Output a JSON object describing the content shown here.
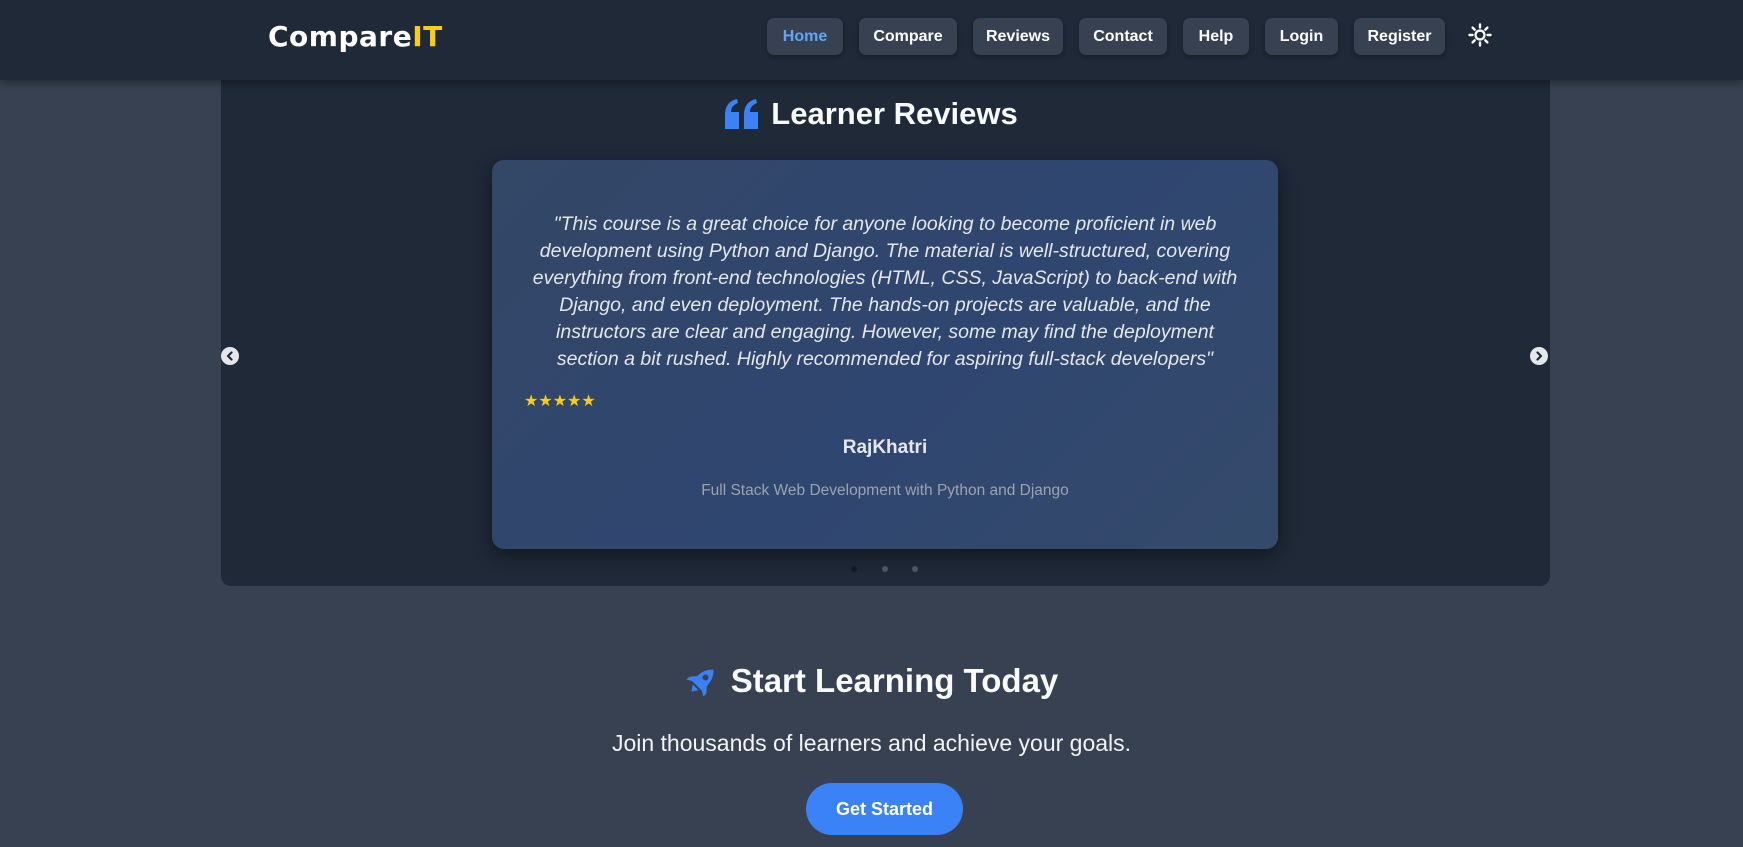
{
  "header": {
    "logo_main": "Compare",
    "logo_accent": "IT",
    "logo_accent_color": "#facc15",
    "nav": [
      {
        "label": "Home",
        "active": true
      },
      {
        "label": "Compare"
      },
      {
        "label": "Reviews"
      },
      {
        "label": "Contact"
      },
      {
        "label": "Help"
      },
      {
        "label": "Login"
      },
      {
        "label": "Register"
      }
    ],
    "theme_toggle_icon": "sun-icon"
  },
  "reviews": {
    "title": "Learner Reviews",
    "title_icon": "quote-icon",
    "review": {
      "text": "\"This course is a great choice for anyone looking to become proficient in web development using Python and Django. The material is well-structured, covering everything from front-end technologies (HTML, CSS, JavaScript) to back-end with Django, and even deployment. The hands-on projects are valuable, and the instructors are clear and engaging. However, some may find the deployment section a bit rushed. Highly recommended for aspiring full-stack developers\"",
      "stars": "★★★★★",
      "rating": 5,
      "reviewer": "RajKhatri",
      "course": "Full Stack Web Development with Python and Django"
    },
    "carousel": {
      "slides": 3,
      "active_slide": 1,
      "prev_icon": "chevron-left-icon",
      "next_icon": "chevron-right-icon"
    }
  },
  "cta": {
    "title": "Start Learning Today",
    "title_icon": "rocket-icon",
    "subtitle": "Join thousands of learners and achieve your goals.",
    "button_label": "Get Started"
  },
  "colors": {
    "accent": "#3b82f6",
    "header_bg": "#1f2937",
    "page_bg": "#374151",
    "star": "#facc15"
  }
}
